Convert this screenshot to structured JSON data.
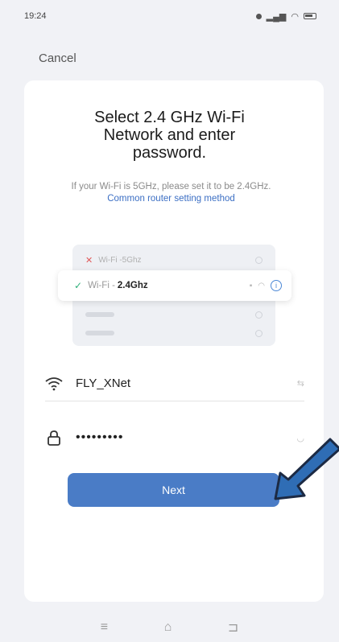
{
  "status_bar": {
    "time": "19:24"
  },
  "header": {
    "cancel_label": "Cancel"
  },
  "title": {
    "line1": "Select 2.4 GHz Wi-Fi",
    "line2": "Network and enter",
    "line3": "password."
  },
  "hint": {
    "text": "If your Wi-Fi is 5GHz, please set it to be 2.4GHz.",
    "link": "Common router setting method"
  },
  "illustration": {
    "row_5g_prefix": "Wi-Fi - ",
    "row_5g_band": "5Ghz",
    "row_24_prefix": "Wi-Fi - ",
    "row_24_band": "2.4Ghz"
  },
  "form": {
    "network_name": "FLY_XNet",
    "password_masked": "•••••••••"
  },
  "next_button": {
    "label": "Next"
  },
  "colors": {
    "accent": "#4a7cc6",
    "link": "#3c6fc4",
    "arrow": "#2f6db5",
    "check": "#2eb07a",
    "cross": "#e05a5a"
  },
  "icons": {
    "wifi": "wifi-icon",
    "lock": "lock-icon",
    "annotation": "arrow-icon"
  }
}
